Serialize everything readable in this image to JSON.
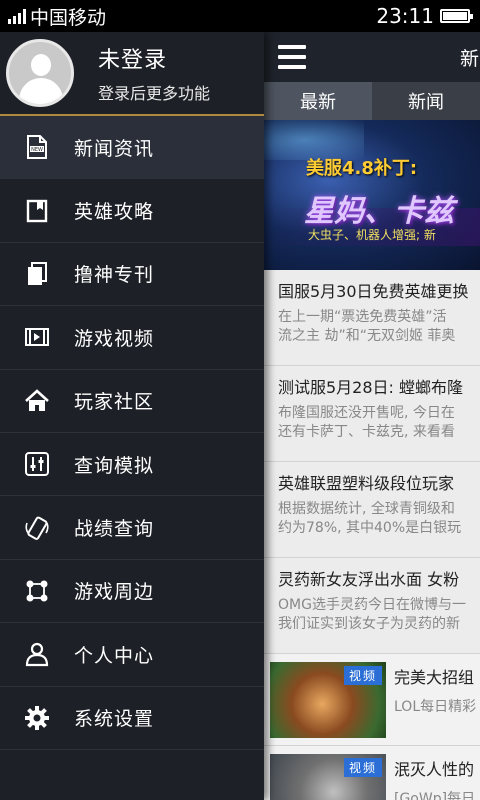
{
  "status": {
    "carrier": "中国移动",
    "time": "23:11",
    "battery_level": 1.0
  },
  "drawer": {
    "profile": {
      "name": "未登录",
      "subtitle": "登录后更多功能"
    },
    "items": [
      {
        "label": "新闻资讯",
        "icon": "news-icon",
        "active": true
      },
      {
        "label": "英雄攻略",
        "icon": "guide-book-icon"
      },
      {
        "label": "撸神专刊",
        "icon": "magazine-icon"
      },
      {
        "label": "游戏视频",
        "icon": "video-film-icon"
      },
      {
        "label": "玩家社区",
        "icon": "home-icon"
      },
      {
        "label": "查询模拟",
        "icon": "sliders-icon"
      },
      {
        "label": "战绩查询",
        "icon": "phone-vibrate-icon"
      },
      {
        "label": "游戏周边",
        "icon": "nodes-icon"
      },
      {
        "label": "个人中心",
        "icon": "user-icon"
      },
      {
        "label": "系统设置",
        "icon": "gear-icon"
      }
    ],
    "accent_color": "#b08a3e"
  },
  "main": {
    "title": "新",
    "tabs": [
      {
        "label": "最新",
        "active": true
      },
      {
        "label": "新闻"
      }
    ],
    "banner": {
      "line1": "美服4.8补丁:",
      "line2": "星妈、卡兹",
      "line3": "大虫子、机器人增强; 新"
    },
    "news": [
      {
        "title": "国服5月30日免费英雄更换",
        "desc1": "在上一期“票选免费英雄”活",
        "desc2": "流之主 劫”和“无双剑姬 菲奥"
      },
      {
        "title": "测试服5月28日: 螳螂布隆",
        "desc1": "布隆国服还没开售呢, 今日在",
        "desc2": "还有卡萨丁、卡兹克, 来看看"
      },
      {
        "title": "英雄联盟塑料级段位玩家",
        "desc1": "根据数据统计, 全球青铜级和",
        "desc2": "约为78%, 其中40%是白银玩"
      },
      {
        "title": "灵药新女友浮出水面 女粉",
        "desc1": "OMG选手灵药今日在微博与一",
        "desc2": "我们证实到该女子为灵药的新"
      }
    ],
    "videos": [
      {
        "badge": "视频",
        "title": "完美大招组",
        "desc": "LOL每日精彩"
      },
      {
        "badge": "视频",
        "title": "泯灭人性的",
        "desc": "[GoWp]每日"
      }
    ]
  }
}
